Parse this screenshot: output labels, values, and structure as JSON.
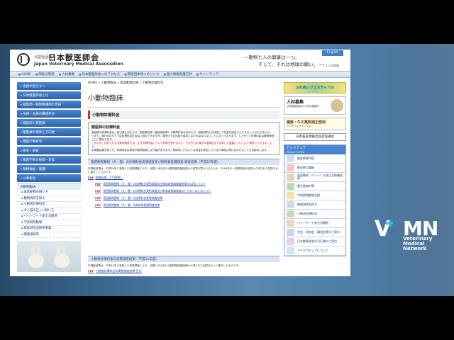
{
  "header": {
    "org_small": "公益社団法人",
    "org_name": "日本獣医師会",
    "org_en": "Japan Veterinary Medical Association",
    "slogan_line1": "〜動物と人の健康は一つ。",
    "slogan_line2": "そして、それは地球の願い。〜",
    "english_button": "English",
    "site_map": "サイトの地図"
  },
  "nav": [
    "HOME",
    "関係法制等",
    "人材募集",
    "日本獣医師会へのアクセス",
    "関係団体等へのリンク",
    "個人情報保護方針",
    "サイトマップ"
  ],
  "sidebar": {
    "buttons_top": [
      "会員の皆さまへ",
      "日本獣医師会とは",
      "獣医師・動物看護師の皆様",
      "役員・会員の構成状況",
      "獣医師と獣医療",
      "獣医療の現状と方向性",
      "獣医学教育等",
      "研究・調査"
    ],
    "buttons_mid": [
      "獣医学術の振興・普及",
      "動物福祉・愛護",
      "公衆衛生"
    ],
    "section_title": "小動物臨床",
    "links": [
      "家庭動物の飼い方",
      "動物病院を探す",
      "小動物診療料金",
      "犬と猫の正しい飼い方",
      "ペットフード安全法関係",
      "学校飼育動物",
      "獣医師生涯研修事業",
      "関連通知等"
    ]
  },
  "main": {
    "breadcrumb": "HOME » 小動物臨床 » 家庭動物診療 » 小動物診療料金",
    "title": "小動物臨床",
    "section_title": "小動物診療料金",
    "fee_box_title": "獣医師の診療料金",
    "fee_para1": "獣医師の診療料金は、独占禁止法により、獣医師団体（獣医師会等）が基準料金を決めたり、獣医師同士が協定して料金を設定したりすることはできません。",
    "fee_para2": "つまり、現行法のもとでは診療料金を自由に設定できますが、競争できる体制を維持しなければならないことになっております。したがって診療料金は動物病院ごとに異なります。",
    "fee_para3_red": "このため、初めてかかる動物病院では、まず診療料金について説明を受けるなど、それぞれの項目の金額を全て合算した金額についてよく確認しておきましょう。",
    "fee_para4": "本調査結果を見ても、診療料金は地域や動物病院により幅があります。具体的にどのような料金を設定しているか事前に問い合わせることをお勧めします。",
    "survey_head": "家庭飼育動物（犬・猫）の診療料金実態調査及び飼育者意識調査 調査結果（平成27年度）",
    "survey_text": "本調査結果は、平成26年に実施した実態調査により、全国1,365名の小動物臨床獣医師から回答が寄せられたもの、3096名の一般飼育者の回答から得られた回答を元に集計したものです。",
    "pdf_link": "調査結果（27.8MB）",
    "survey_items": [
      "家庭飼育動物（犬・猫）の診療料金実態調査及び飼育者意識調査結果の公表について",
      "家庭飼育動物（犬・猫）の診療料金実態調査及び飼育者意識調査のとりまとめにあたって",
      "家庭飼育動物（犬・猫）の診療料金実態調査結果",
      "家庭飼育動物（犬・猫）の飼育者意識調査結果"
    ],
    "survey2_head": "小動物診療料金の実態調査結果（平成11年度）",
    "survey2_text": "本調査結果は、平成11年に実施した実態調査により、全国1,631名の小動物臨床獣医師から得られた回答をもとに集計したものです。",
    "survey2_link": "小動物診療料金の実態調査結果 目次"
  },
  "right": {
    "festival_banner": "ふれあいフェスティバル",
    "recruit_title": "人材募集",
    "recruit_sub": "日本獣医師会の人材を募集中",
    "drug_title": "養豚・牛の薬剤適正使用",
    "drug_sub": "アンチバイオティクス",
    "livestock": "日本畜産物輸出促進協議会",
    "pickup_title": "ピックアップ",
    "pickup_sub": "PICK UP TOPICS",
    "pickup_items": [
      "獣医師専門医",
      "獣医師の職能",
      "家庭動物（ペット）の適正な飼養管理",
      "野生動物対策",
      "学校飼育動物支援",
      "動物病院を探す",
      "小動物診療料金",
      "ペットフード安全法関係",
      "学会・研修会・講習会等のご案内",
      "日本獣医師会の刊行物のご案内",
      "マイクロチップについて"
    ]
  },
  "vmn": {
    "letters": "MN",
    "v": "V",
    "line1": "Veterinary",
    "line2": "Medical",
    "line3": "Network"
  }
}
